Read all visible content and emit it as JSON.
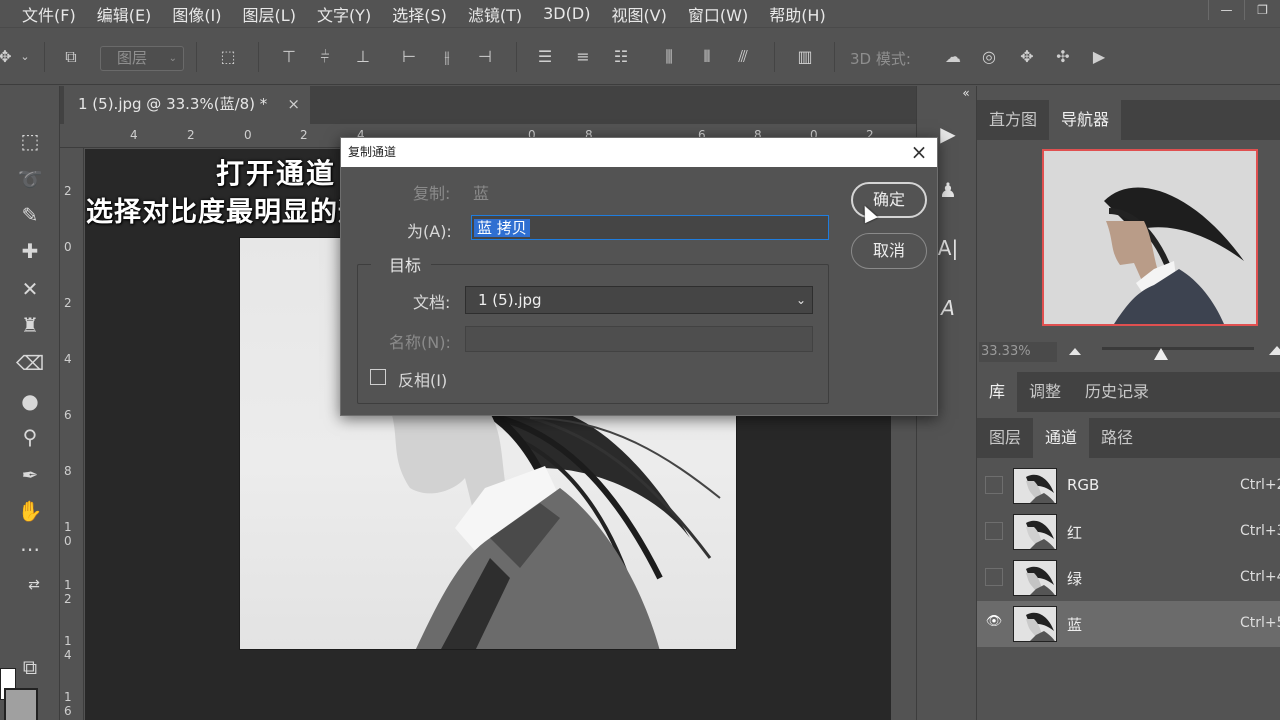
{
  "menu": [
    "文件(F)",
    "编辑(E)",
    "图像(I)",
    "图层(L)",
    "文字(Y)",
    "选择(S)",
    "滤镜(T)",
    "3D(D)",
    "视图(V)",
    "窗口(W)",
    "帮助(H)"
  ],
  "window_buttons": [
    "—",
    "❐"
  ],
  "options_bar": {
    "layer_select": "图层",
    "mode_3d": "3D 模式:"
  },
  "document": {
    "tab_title": "1 (5).jpg @ 33.3%(蓝/8) *",
    "close": "×",
    "ruler_top": [
      "4",
      "2",
      "0",
      "2",
      "4",
      "0",
      "8",
      "6",
      "8",
      "0",
      "2"
    ],
    "ruler_left": [
      "2",
      "0",
      "2",
      "4",
      "6",
      "8",
      "1 0",
      "1 2",
      "1 4",
      "1 6"
    ]
  },
  "captions": {
    "line1": "打开通道",
    "line2": "选择对比度最明显的通道"
  },
  "panels": {
    "top_tabs": [
      "直方图",
      "导航器"
    ],
    "zoom": "33.33%",
    "mid_tabs": [
      "库",
      "调整",
      "历史记录"
    ],
    "bottom_tabs": [
      "图层",
      "通道",
      "路径"
    ],
    "channels": [
      {
        "name": "RGB",
        "shortcut": "Ctrl+2",
        "visible": false
      },
      {
        "name": "红",
        "shortcut": "Ctrl+3",
        "visible": false
      },
      {
        "name": "绿",
        "shortcut": "Ctrl+4",
        "visible": false
      },
      {
        "name": "蓝",
        "shortcut": "Ctrl+5",
        "visible": true
      }
    ]
  },
  "dialog": {
    "title": "复制通道",
    "close": "×",
    "copy_label": "复制:",
    "copy_value": "蓝",
    "as_label": "为(A):",
    "as_value": "蓝 拷贝",
    "target_label": "目标",
    "doc_label": "文档:",
    "doc_value": "1 (5).jpg",
    "name_label": "名称(N):",
    "invert_label": "反相(I)",
    "ok": "确定",
    "cancel": "取消"
  }
}
